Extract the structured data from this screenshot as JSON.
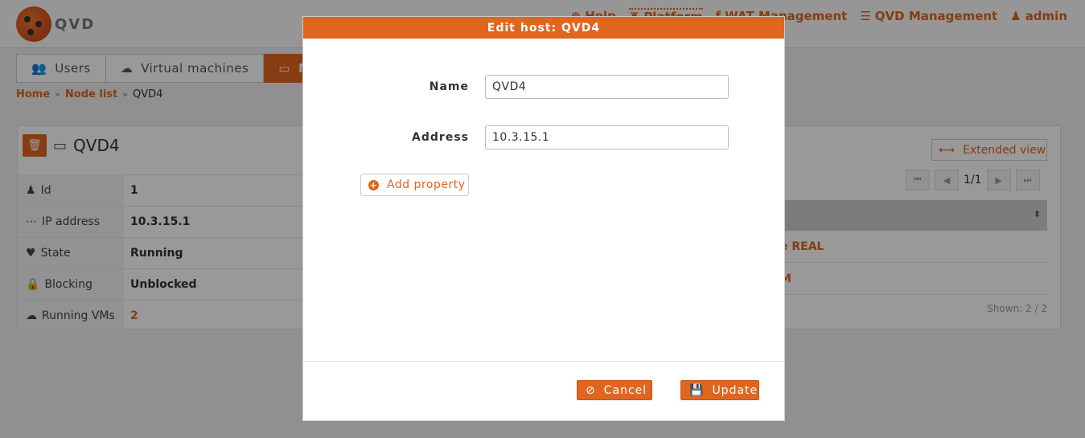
{
  "app": {
    "logo_text": "QVD",
    "topnav": [
      {
        "label": "Help",
        "icon": "lifebuoy-icon"
      },
      {
        "label": "Platform",
        "icon": "platform-icon"
      },
      {
        "label": "WAT Management",
        "icon": "wrench-icon"
      },
      {
        "label": "QVD Management",
        "icon": "sliders-icon"
      },
      {
        "label": "admin",
        "icon": "user-icon"
      }
    ],
    "tabs": [
      {
        "label": "Users",
        "icon": "users-icon"
      },
      {
        "label": "Virtual machines",
        "icon": "cloud-icon"
      },
      {
        "label": "N",
        "icon": "hdd-icon"
      }
    ],
    "breadcrumb": {
      "home": "Home",
      "node_list": "Node list",
      "current": "QVD4"
    },
    "detail": {
      "title": "QVD4",
      "properties": [
        {
          "key": "Id",
          "value": "1",
          "icon": "user-icon"
        },
        {
          "key": "IP address",
          "value": "10.3.15.1",
          "icon": "ellipsis-icon"
        },
        {
          "key": "State",
          "value": "Running",
          "icon": "heart-icon"
        },
        {
          "key": "Blocking",
          "value": "Unblocked",
          "icon": "lock-icon"
        },
        {
          "key": "Running VMs",
          "value": "2",
          "icon": "cloud-icon"
        }
      ]
    },
    "extended_view_label": "Extended view",
    "pager_label": "1/1",
    "vm_rows": [
      "e REAL",
      "M"
    ],
    "shown_label": "Shown: 2 / 2"
  },
  "modal": {
    "title": "Edit host: QVD4",
    "name_label": "Name",
    "name_value": "QVD4",
    "address_label": "Address",
    "address_value": "10.3.15.1",
    "add_property_label": "Add property",
    "cancel_label": "Cancel",
    "update_label": "Update"
  },
  "colors": {
    "accent": "#e0661f",
    "overlay": "rgba(0,0,0,0.4)"
  }
}
